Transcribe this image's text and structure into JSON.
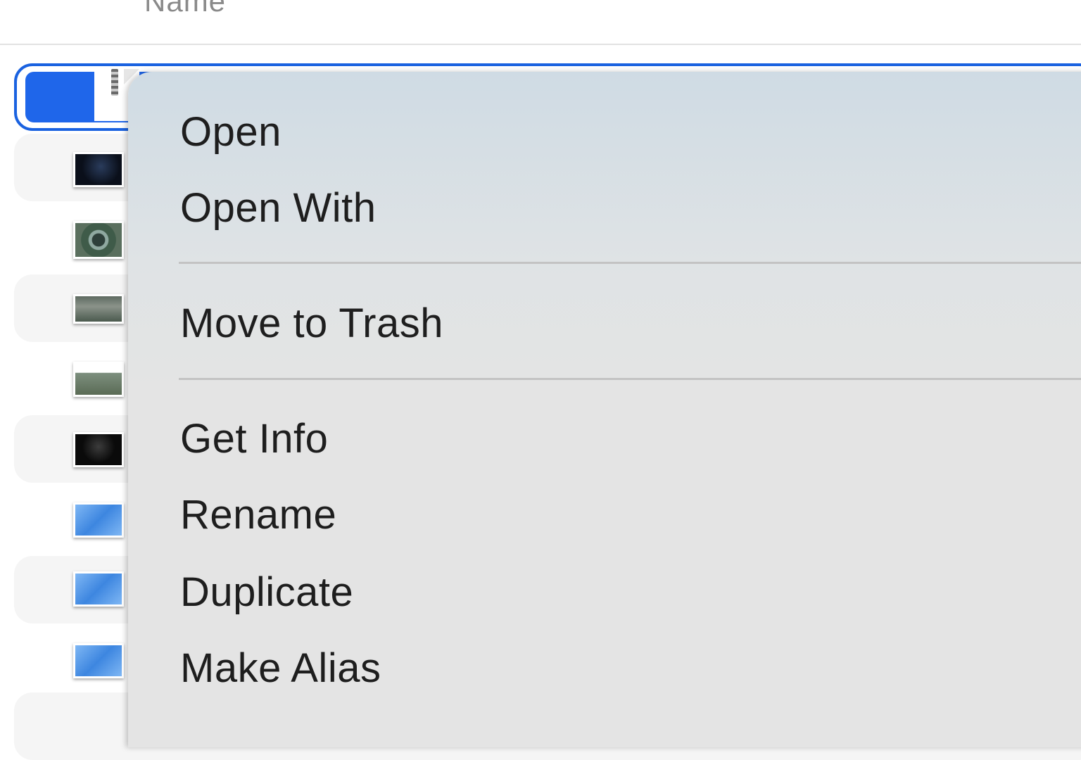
{
  "column_header": {
    "name_label": "Name"
  },
  "file_list": {
    "items": [
      {
        "icon": "archive-document-icon",
        "selected": true
      },
      {
        "icon": "image-thumbnail-dark-icon"
      },
      {
        "icon": "image-thumbnail-campus-round-icon"
      },
      {
        "icon": "image-thumbnail-campus-aerial-icon"
      },
      {
        "icon": "image-thumbnail-park-icon"
      },
      {
        "icon": "image-thumbnail-wwdc-icon"
      },
      {
        "icon": "image-thumbnail-blue-icon"
      },
      {
        "icon": "image-thumbnail-blue-icon"
      },
      {
        "icon": "image-thumbnail-blue-icon"
      }
    ]
  },
  "context_menu": {
    "open": "Open",
    "open_with": "Open With",
    "move_to_trash": "Move to Trash",
    "get_info": "Get Info",
    "rename": "Rename",
    "duplicate": "Duplicate",
    "make_alias": "Make Alias"
  },
  "colors": {
    "selection": "#1f66ea",
    "selection_border": "#1a62e0",
    "menu_background": "#e4e4e4"
  }
}
